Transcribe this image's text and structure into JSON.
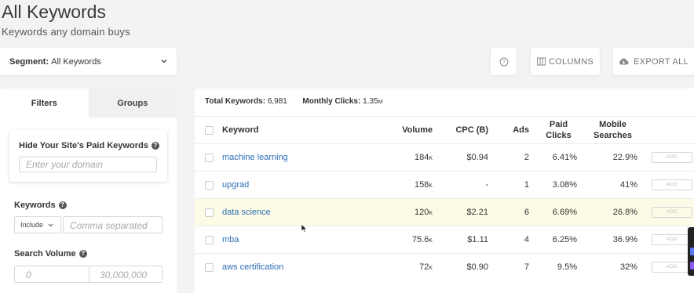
{
  "header": {
    "title": "All Keywords",
    "subtitle": "Keywords any domain buys"
  },
  "segment": {
    "label": "Segment:",
    "value": "All Keywords"
  },
  "toolbar": {
    "help_label": "?",
    "columns_label": "COLUMNS",
    "export_label": "EXPORT ALL"
  },
  "filters": {
    "tabs": [
      "Filters",
      "Groups"
    ],
    "paid_keywords_label": "Hide Your Site's Paid Keywords",
    "domain_placeholder": "Enter your domain",
    "keywords_label": "Keywords",
    "include_value": "Include",
    "keywords_placeholder": "Comma separated",
    "search_volume_label": "Search Volume",
    "volume_min_placeholder": "0",
    "volume_max_placeholder": "30,000,000"
  },
  "summary": {
    "total_label": "Total Keywords:",
    "total_value": "6,981",
    "clicks_label": "Monthly Clicks:",
    "clicks_value": "1.35",
    "clicks_unit": "M"
  },
  "table": {
    "headers": {
      "keyword": "Keyword",
      "volume": "Volume",
      "cpc": "CPC (B)",
      "ads": "Ads",
      "paid_clicks_1": "Paid",
      "paid_clicks_2": "Clicks",
      "mobile_1": "Mobile",
      "mobile_2": "Searches"
    },
    "add_label": "ADD",
    "rows": [
      {
        "keyword": "machine learning",
        "volume": "184",
        "unit": "K",
        "cpc": "$0.94",
        "ads": "2",
        "paid_clicks": "6.41%",
        "mobile": "22.9%"
      },
      {
        "keyword": "upgrad",
        "volume": "158",
        "unit": "K",
        "cpc": "-",
        "ads": "1",
        "paid_clicks": "3.08%",
        "mobile": "41%"
      },
      {
        "keyword": "data science",
        "volume": "120",
        "unit": "K",
        "cpc": "$2.21",
        "ads": "6",
        "paid_clicks": "6.69%",
        "mobile": "26.8%"
      },
      {
        "keyword": "mba",
        "volume": "75.6",
        "unit": "K",
        "cpc": "$1.11",
        "ads": "4",
        "paid_clicks": "6.25%",
        "mobile": "36.9%"
      },
      {
        "keyword": "aws certification",
        "volume": "72",
        "unit": "K",
        "cpc": "$0.90",
        "ads": "7",
        "paid_clicks": "9.5%",
        "mobile": "32%"
      }
    ]
  }
}
